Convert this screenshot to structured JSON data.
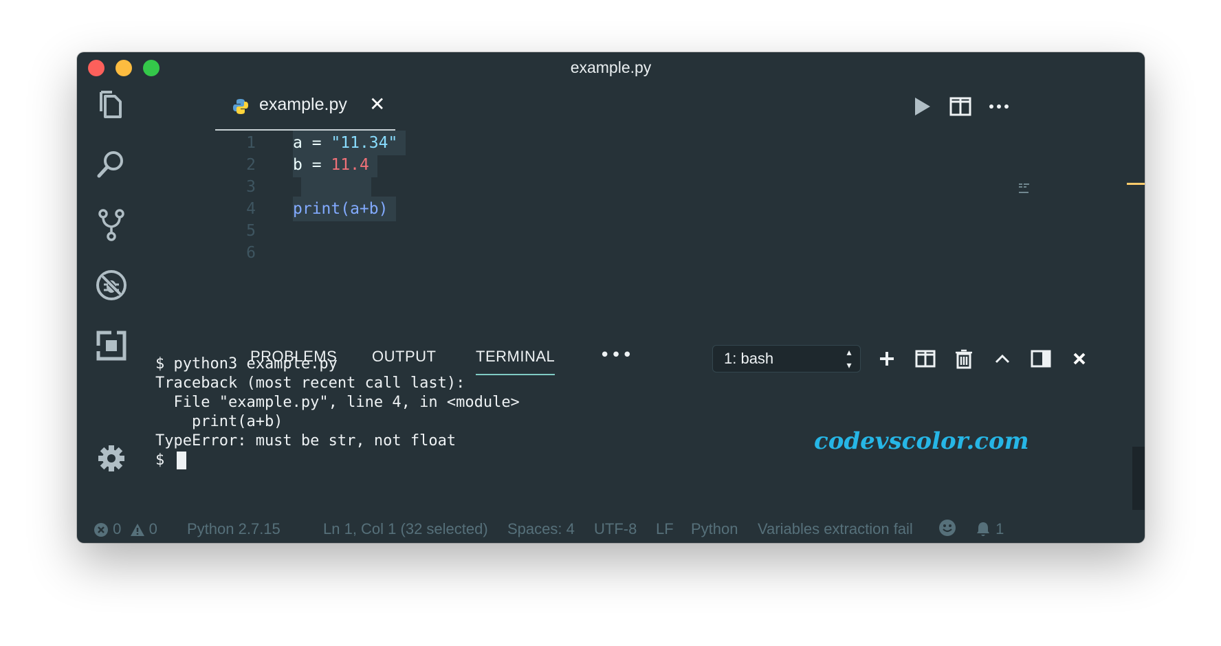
{
  "window": {
    "title": "example.py"
  },
  "activity_bar": {
    "items": [
      {
        "name": "explorer-icon"
      },
      {
        "name": "search-icon"
      },
      {
        "name": "source-control-icon"
      },
      {
        "name": "debug-icon"
      },
      {
        "name": "extensions-icon"
      },
      {
        "name": "settings-gear-icon"
      }
    ]
  },
  "tabs": [
    {
      "label": "example.py",
      "close": "✕",
      "icon": "python-icon"
    }
  ],
  "editor": {
    "lines": [
      {
        "number": "1",
        "var": "a",
        "op": " = ",
        "value": "\"11.34\""
      },
      {
        "number": "2",
        "var": "b",
        "op": " = ",
        "value": "11.4"
      },
      {
        "number": "3"
      },
      {
        "number": "4",
        "fn": "print(a+b)"
      },
      {
        "number": "5"
      },
      {
        "number": "6"
      }
    ]
  },
  "panel": {
    "tabs": [
      "PROBLEMS",
      "OUTPUT",
      "TERMINAL"
    ],
    "active_tab": "TERMINAL",
    "more": "•••",
    "terminal_select": "1: bash",
    "terminal_lines": [
      "$ python3 example.py",
      "Traceback (most recent call last):",
      "  File \"example.py\", line 4, in <module>",
      "    print(a+b)",
      "TypeError: must be str, not float",
      "$ "
    ]
  },
  "watermark": "codevscolor.com",
  "status_bar": {
    "errors": "0",
    "warnings": "0",
    "interpreter": "Python 2.7.15",
    "position": "Ln 1, Col 1 (32 selected)",
    "spaces": "Spaces: 4",
    "encoding": "UTF-8",
    "eol": "LF",
    "language": "Python",
    "message": "Variables extraction fail",
    "notifications": "1"
  },
  "colors": {
    "background": "#263238",
    "accent": "#80cbc4",
    "string": "#89ddff",
    "number": "#f07178",
    "function": "#82aaff"
  }
}
